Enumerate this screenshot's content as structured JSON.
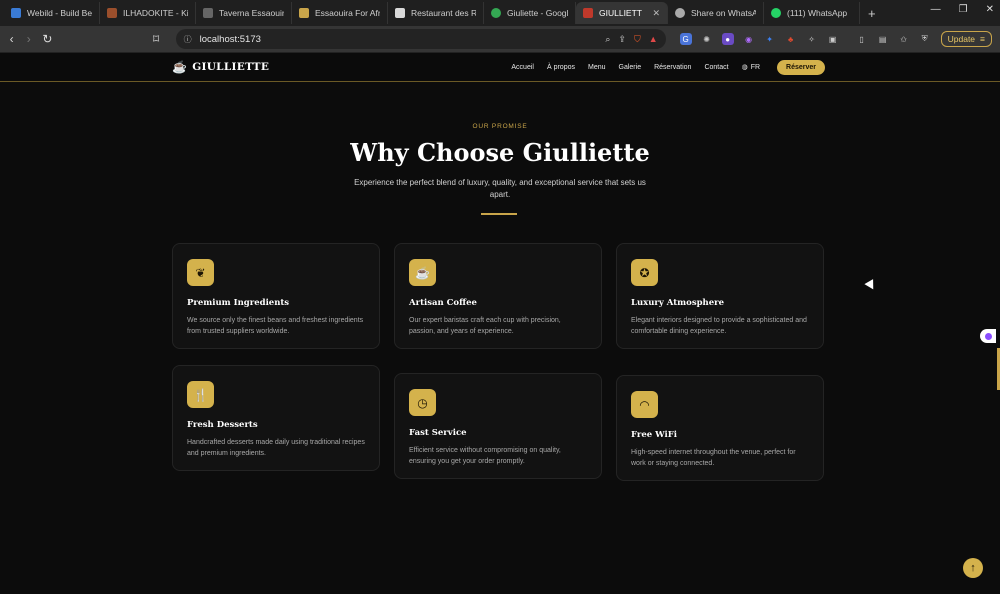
{
  "browser": {
    "tabs": [
      {
        "label": "Webild - Build Bea",
        "color": "#3a7bd5"
      },
      {
        "label": "ILHADOKITE - Kite",
        "color": "#9b4f2c"
      },
      {
        "label": "Taverna Essaouira",
        "color": "#666666"
      },
      {
        "label": "Essaouira For Afric",
        "color": "#c9a54a"
      },
      {
        "label": "Restaurant des Rê",
        "color": "#d9d9d9"
      },
      {
        "label": "Giuliette - Google",
        "color": "#34a853"
      },
      {
        "label": "GIULLIETTE |",
        "color": "#c0392b"
      },
      {
        "label": "Share on WhatsAp",
        "color": "#aaaaaa"
      },
      {
        "label": "(111) WhatsApp",
        "color": "#25d366"
      }
    ],
    "url": "localhost:5173",
    "update_label": "Update"
  },
  "site": {
    "brand": "GIULLIETTE",
    "nav": [
      "Accueil",
      "À propos",
      "Menu",
      "Galerie",
      "Réservation",
      "Contact"
    ],
    "lang": "FR",
    "reserve_label": "Réserver"
  },
  "section": {
    "eyebrow": "OUR PROMISE",
    "title": "Why Choose Giulliette",
    "subtitle": "Experience the perfect blend of luxury, quality, and exceptional service that sets us apart."
  },
  "features": [
    {
      "title": "Premium Ingredients",
      "desc": "We source only the finest beans and freshest ingredients from trusted suppliers worldwide.",
      "icon": "leaf-icon"
    },
    {
      "title": "Artisan Coffee",
      "desc": "Our expert baristas craft each cup with precision, passion, and years of experience.",
      "icon": "coffee-icon"
    },
    {
      "title": "Luxury Atmosphere",
      "desc": "Elegant interiors designed to provide a sophisticated and comfortable dining experience.",
      "icon": "award-icon"
    },
    {
      "title": "Fresh Desserts",
      "desc": "Handcrafted desserts made daily using traditional recipes and premium ingredients.",
      "icon": "utensils-icon"
    },
    {
      "title": "Fast Service",
      "desc": "Efficient service without compromising on quality, ensuring you get your order promptly.",
      "icon": "clock-icon"
    },
    {
      "title": "Free WiFi",
      "desc": "High-speed internet throughout the venue, perfect for work or staying connected.",
      "icon": "wifi-icon"
    }
  ],
  "colors": {
    "accent": "#d4b24c",
    "background": "#0c0c0c"
  }
}
